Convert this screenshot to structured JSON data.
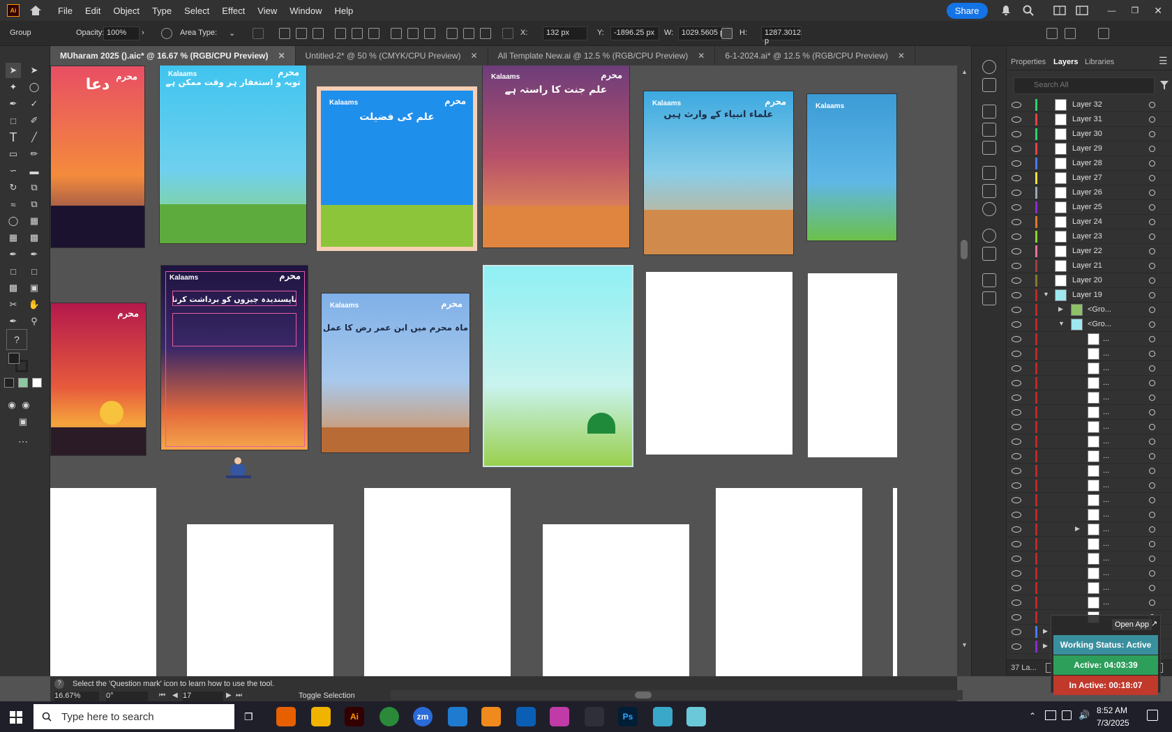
{
  "menu": {
    "app_icon": "Ai",
    "items": [
      "File",
      "Edit",
      "Object",
      "Type",
      "Select",
      "Effect",
      "View",
      "Window",
      "Help"
    ],
    "share_label": "Share"
  },
  "control": {
    "selection_type": "Group",
    "opacity_label": "Opacity:",
    "opacity_value": "100%",
    "area_type_label": "Area Type:",
    "x_label": "X:",
    "x_value": "132 px",
    "y_label": "Y:",
    "y_value": "-1896.25 px",
    "w_label": "W:",
    "w_value": "1029.5605 p",
    "h_label": "H:",
    "h_value": "1287.3012 p"
  },
  "tabs": [
    {
      "label": "MUharam 2025 ().aic* @ 16.67 % (RGB/CPU Preview)"
    },
    {
      "label": "Untitled-2* @ 50 % (CMYK/CPU Preview)"
    },
    {
      "label": "All Template New.ai @ 12.5 % (RGB/CPU Preview)"
    },
    {
      "label": "6-1-2024.ai* @ 12.5 % (RGB/CPU Preview)"
    }
  ],
  "posters": [
    {
      "title": "دعا",
      "brand": "",
      "badge": "محرم"
    },
    {
      "title": "توبہ و استغفار ہر وقت ممکن ہے",
      "brand": "Kalaams",
      "badge": "محرم"
    },
    {
      "title": "علم کی فضیلت",
      "brand": "Kalaams",
      "badge": "محرم"
    },
    {
      "title": "علم جنت کا راستہ ہے",
      "brand": "Kalaams",
      "badge": "محرم"
    },
    {
      "title": "علماء انبیاء کے وارث ہیں",
      "brand": "Kalaams",
      "badge": "محرم"
    },
    {
      "title": "",
      "brand": "Kalaams",
      "badge": ""
    },
    {
      "title": "",
      "brand": "",
      "badge": "محرم"
    },
    {
      "title": "ناپسندیدہ چیزوں کو برداشت کرنا",
      "brand": "Kalaams",
      "badge": "محرم"
    },
    {
      "title": "ماہ محرم میں ابن عمر رض کا عمل",
      "brand": "Kalaams",
      "badge": "محرم"
    }
  ],
  "panel": {
    "tabs": [
      "Properties",
      "Layers",
      "Libraries"
    ],
    "search_placeholder": "Search All",
    "layers": [
      "Layer 32",
      "Layer 31",
      "Layer 30",
      "Layer 29",
      "Layer 28",
      "Layer 27",
      "Layer 26",
      "Layer 25",
      "Layer 24",
      "Layer 23",
      "Layer 22",
      "Layer 21",
      "Layer 20",
      "Layer 19"
    ],
    "sublayers": [
      "<Gro...",
      "<Gro..."
    ],
    "sub_items": "...",
    "footer_count": "37 La..."
  },
  "overlay": {
    "open_app": "Open App",
    "working_status": "Working Status: Active",
    "active_time": "Active: 04:03:39",
    "inactive_time": "In Active: 00:18:07"
  },
  "status": {
    "hint": "Select the 'Question mark' icon to learn how to use the tool.",
    "zoom": "16.67%",
    "rotation": "0°",
    "artboard": "17",
    "mode": "Toggle Selection"
  },
  "taskbar": {
    "search_placeholder": "Type here to search",
    "time": "8:52 AM",
    "date": "7/3/2025"
  },
  "colors": {
    "accent": "#1473e6",
    "working": "#3a8f9e",
    "active": "#2e9e5b",
    "inactive": "#c0392b"
  }
}
